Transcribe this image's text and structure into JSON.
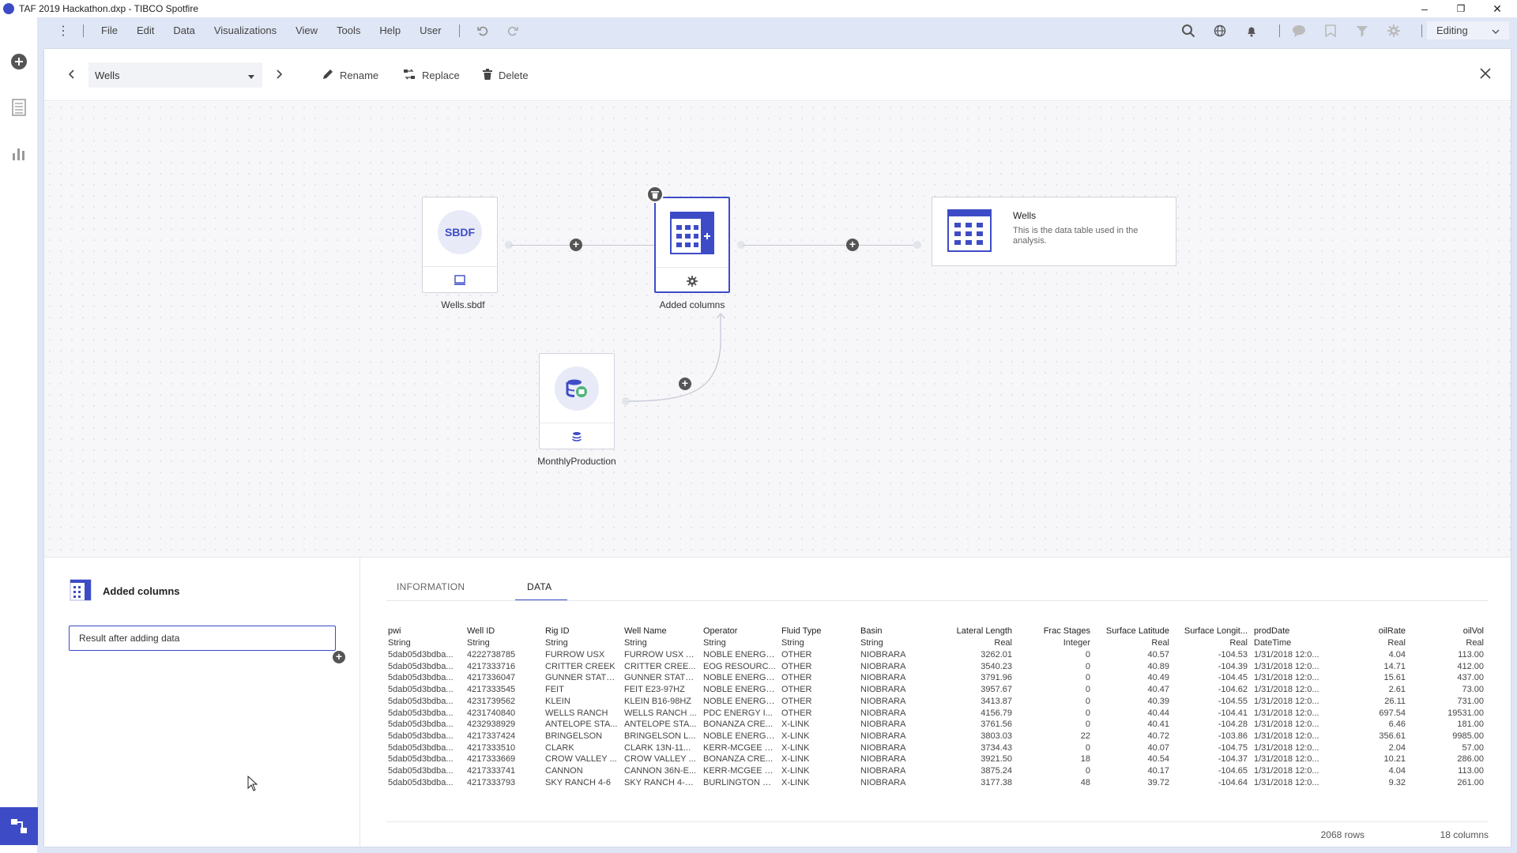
{
  "window": {
    "title": "TAF 2019 Hackathon.dxp - TIBCO Spotfire",
    "minimize": "–",
    "restore": "❐",
    "close": "✕"
  },
  "menu": {
    "items": [
      "File",
      "Edit",
      "Data",
      "Visualizations",
      "View",
      "Tools",
      "Help",
      "User"
    ],
    "mode": "Editing"
  },
  "header": {
    "selected_table": "Wells",
    "rename": "Rename",
    "replace": "Replace",
    "delete": "Delete"
  },
  "canvas": {
    "source_node": {
      "icon_text": "SBDF",
      "label": "Wells.sbdf"
    },
    "transform_node": {
      "label": "Added columns"
    },
    "added_node": {
      "label": "MonthlyProduction"
    },
    "result": {
      "title": "Wells",
      "description": "This is the data table used in the analysis."
    }
  },
  "details": {
    "title": "Added columns",
    "result_field": "Result after adding data",
    "tabs": [
      "INFORMATION",
      "DATA"
    ],
    "active_tab": "DATA",
    "rows_count": "2068 rows",
    "cols_count": "18 columns"
  },
  "grid": {
    "headers": [
      "pwi",
      "Well ID",
      "Rig ID",
      "Well Name",
      "Operator",
      "Fluid Type",
      "Basin",
      "Lateral Length",
      "Frac Stages",
      "Surface Latitude",
      "Surface Longit...",
      "prodDate",
      "oilRate",
      "oilVol"
    ],
    "types": [
      "String",
      "String",
      "String",
      "String",
      "String",
      "String",
      "String",
      "Real",
      "Integer",
      "Real",
      "Real",
      "DateTime",
      "Real",
      "Real"
    ],
    "rows": [
      [
        "5dab05d3bdba...",
        "4222738785",
        "FURROW USX",
        "FURROW USX A...",
        "NOBLE ENERGY...",
        "OTHER",
        "NIOBRARA",
        "3262.01",
        "0",
        "40.57",
        "-104.53",
        "1/31/2018 12:0...",
        "4.04",
        "113.00"
      ],
      [
        "5dab05d3bdba...",
        "4217333716",
        "CRITTER CREEK",
        "CRITTER CREE...",
        "EOG RESOURC...",
        "OTHER",
        "NIOBRARA",
        "3540.23",
        "0",
        "40.89",
        "-104.39",
        "1/31/2018 12:0...",
        "14.71",
        "412.00"
      ],
      [
        "5dab05d3bdba...",
        "4217336047",
        "GUNNER STATE...",
        "GUNNER STATE...",
        "NOBLE ENERGY...",
        "OTHER",
        "NIOBRARA",
        "3791.96",
        "0",
        "40.49",
        "-104.45",
        "1/31/2018 12:0...",
        "15.61",
        "437.00"
      ],
      [
        "5dab05d3bdba...",
        "4217333545",
        "FEIT",
        "FEIT E23-97HZ",
        "NOBLE ENERGY...",
        "OTHER",
        "NIOBRARA",
        "3957.67",
        "0",
        "40.47",
        "-104.62",
        "1/31/2018 12:0...",
        "2.61",
        "73.00"
      ],
      [
        "5dab05d3bdba...",
        "4231739562",
        "KLEIN",
        "KLEIN B16-98HZ",
        "NOBLE ENERGY...",
        "OTHER",
        "NIOBRARA",
        "3413.87",
        "0",
        "40.39",
        "-104.55",
        "1/31/2018 12:0...",
        "26.11",
        "731.00"
      ],
      [
        "5dab05d3bdba...",
        "4231740840",
        "WELLS RANCH",
        "WELLS RANCH ...",
        "PDC ENERGY I...",
        "OTHER",
        "NIOBRARA",
        "4156.79",
        "0",
        "40.44",
        "-104.41",
        "1/31/2018 12:0...",
        "697.54",
        "19531.00"
      ],
      [
        "5dab05d3bdba...",
        "4232938929",
        "ANTELOPE STA...",
        "ANTELOPE STA...",
        "BONANZA CRE...",
        "X-LINK",
        "NIOBRARA",
        "3761.56",
        "0",
        "40.41",
        "-104.28",
        "1/31/2018 12:0...",
        "6.46",
        "181.00"
      ],
      [
        "5dab05d3bdba...",
        "4217337424",
        "BRINGELSON",
        "BRINGELSON L...",
        "NOBLE ENERGY...",
        "X-LINK",
        "NIOBRARA",
        "3803.03",
        "22",
        "40.72",
        "-103.86",
        "1/31/2018 12:0...",
        "356.61",
        "9985.00"
      ],
      [
        "5dab05d3bdba...",
        "4217333510",
        "CLARK",
        "CLARK 13N-11...",
        "KERR-MCGEE O...",
        "X-LINK",
        "NIOBRARA",
        "3734.43",
        "0",
        "40.07",
        "-104.75",
        "1/31/2018 12:0...",
        "2.04",
        "57.00"
      ],
      [
        "5dab05d3bdba...",
        "4217333669",
        "CROW VALLEY ...",
        "CROW VALLEY ...",
        "BONANZA CRE...",
        "X-LINK",
        "NIOBRARA",
        "3921.50",
        "18",
        "40.54",
        "-104.37",
        "1/31/2018 12:0...",
        "10.21",
        "286.00"
      ],
      [
        "5dab05d3bdba...",
        "4217333741",
        "CANNON",
        "CANNON 36N-E...",
        "KERR-MCGEE O...",
        "X-LINK",
        "NIOBRARA",
        "3875.24",
        "0",
        "40.17",
        "-104.65",
        "1/31/2018 12:0...",
        "4.04",
        "113.00"
      ],
      [
        "5dab05d3bdba...",
        "4217333793",
        "SKY RANCH 4-6",
        "SKY RANCH 4-6...",
        "BURLINGTON R...",
        "X-LINK",
        "NIOBRARA",
        "3177.38",
        "48",
        "39.72",
        "-104.64",
        "1/31/2018 12:0...",
        "9.32",
        "261.00"
      ]
    ]
  },
  "colors": {
    "accent": "#3d4cc6",
    "menubar": "#dfe6f5",
    "canvas": "#f7f7f9"
  }
}
